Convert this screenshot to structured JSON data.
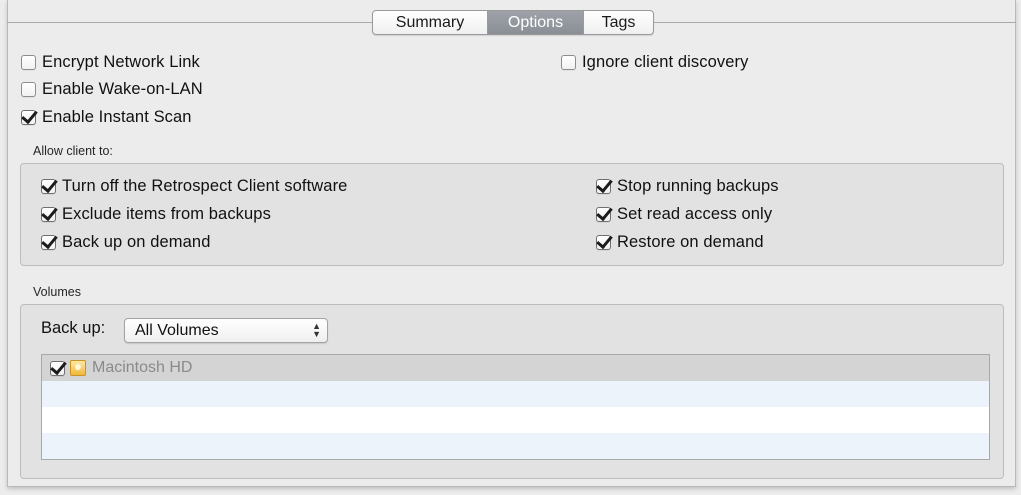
{
  "tabs": [
    {
      "label": "Summary",
      "active": false
    },
    {
      "label": "Options",
      "active": true
    },
    {
      "label": "Tags",
      "active": false
    }
  ],
  "options": {
    "encrypt_network_link": {
      "label": "Encrypt Network Link",
      "checked": false
    },
    "enable_wake_on_lan": {
      "label": "Enable Wake-on-LAN",
      "checked": false
    },
    "enable_instant_scan": {
      "label": "Enable Instant Scan",
      "checked": true
    },
    "ignore_client_discovery": {
      "label": "Ignore client discovery",
      "checked": false
    }
  },
  "allow_client": {
    "label": "Allow client to:",
    "items": [
      {
        "label": "Turn off the Retrospect Client software",
        "checked": true
      },
      {
        "label": "Exclude items from backups",
        "checked": true
      },
      {
        "label": "Back up on demand",
        "checked": true
      },
      {
        "label": "Stop running backups",
        "checked": true
      },
      {
        "label": "Set read access only",
        "checked": true
      },
      {
        "label": "Restore on demand",
        "checked": true
      }
    ]
  },
  "volumes": {
    "label": "Volumes",
    "backup_label": "Back up:",
    "backup_selected": "All Volumes",
    "list": [
      {
        "name": "Macintosh HD",
        "checked": true,
        "icon": "hard-disk-icon"
      }
    ]
  },
  "colors": {
    "active_tab": "#9ea2a8",
    "selected_row": "#d4d4d4",
    "alternate_row": "#edf3fa",
    "group_background": "#e2e2e2"
  }
}
